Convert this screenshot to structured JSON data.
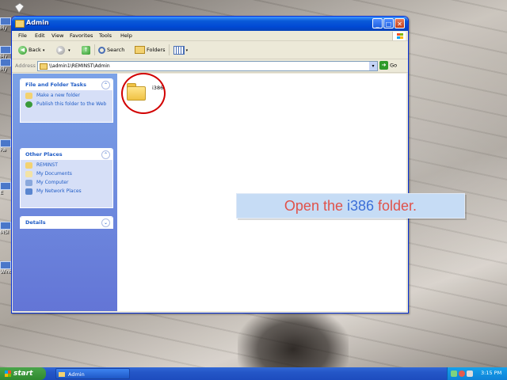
{
  "desktop": {
    "icons": [
      "My",
      "My",
      "My",
      "Re",
      "E",
      "MSI",
      "Wind"
    ]
  },
  "window": {
    "title": "Admin",
    "menu": [
      "File",
      "Edit",
      "View",
      "Favorites",
      "Tools",
      "Help"
    ],
    "toolbar": {
      "back": "Back",
      "search": "Search",
      "folders": "Folders"
    },
    "address": {
      "label": "Address",
      "value": "\\\\admin1\\REMINST\\Admin",
      "go": "Go"
    },
    "tasks_panel": {
      "file_folder_tasks": {
        "title": "File and Folder Tasks",
        "items": [
          "Make a new folder",
          "Publish this folder to the Web"
        ]
      },
      "other_places": {
        "title": "Other Places",
        "items": [
          "REMINST",
          "My Documents",
          "My Computer",
          "My Network Places"
        ]
      },
      "details": {
        "title": "Details"
      }
    },
    "content": {
      "folders": [
        {
          "name": "i386"
        }
      ]
    }
  },
  "instruction": {
    "prefix": "Open the ",
    "highlight": "i386",
    "suffix": " folder."
  },
  "taskbar": {
    "start": "start",
    "window_button": "Admin",
    "clock": "3:15 PM"
  },
  "colors": {
    "accent_blue": "#0054e3",
    "highlight_circle": "#d20000",
    "instruction_text": "#e0524a",
    "instruction_highlight": "#3c6fd8"
  }
}
